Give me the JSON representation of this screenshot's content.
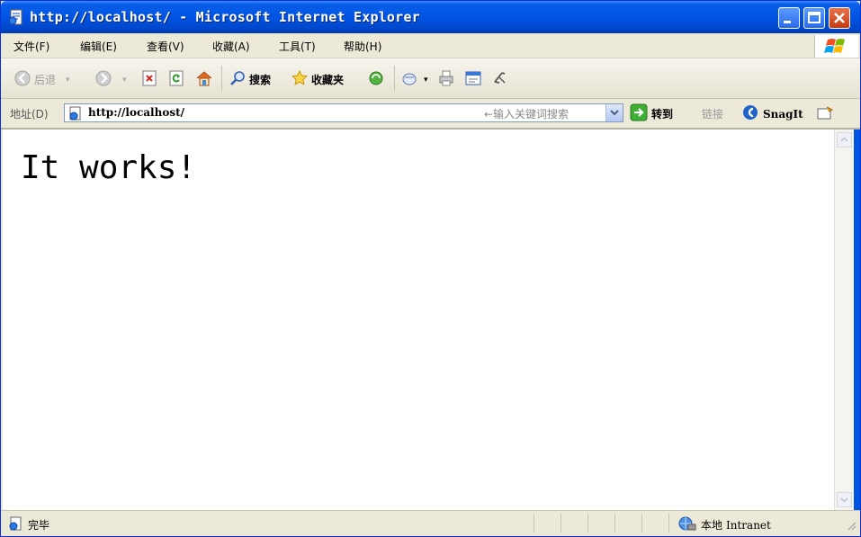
{
  "window": {
    "title": "http://localhost/ - Microsoft Internet Explorer"
  },
  "menubar": {
    "items": [
      "文件(F)",
      "编辑(E)",
      "查看(V)",
      "收藏(A)",
      "工具(T)",
      "帮助(H)"
    ]
  },
  "toolbar": {
    "back_label": "后退",
    "search_label": "搜索",
    "favorites_label": "收藏夹"
  },
  "address": {
    "label": "地址(D)",
    "url": "http://localhost/",
    "hint": "←输入关键词搜索",
    "go_label": "转到",
    "links_label": "链接",
    "snagit_label": "SnagIt"
  },
  "content": {
    "heading": "It works!"
  },
  "status": {
    "text": "完毕",
    "zone_cn": "本地",
    "zone_en": "Intranet"
  },
  "colors": {
    "titlebar": "#0054e3",
    "chrome": "#ece9d8",
    "close_button": "#c53a13"
  }
}
